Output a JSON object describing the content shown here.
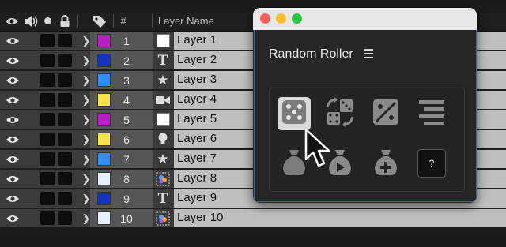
{
  "header": {
    "label_icon": "tag-icon",
    "number_label": "#",
    "name_label": "Layer Name"
  },
  "layers": [
    {
      "num": "1",
      "name": "Layer 1",
      "color": "#b71fc4",
      "source_icon": "solid-white-icon"
    },
    {
      "num": "2",
      "name": "Layer 2",
      "color": "#1533c0",
      "source_icon": "text-icon"
    },
    {
      "num": "3",
      "name": "Layer 3",
      "color": "#2e8ef7",
      "source_icon": "star-icon"
    },
    {
      "num": "4",
      "name": "Layer 4",
      "color": "#f5e34a",
      "source_icon": "camera-icon"
    },
    {
      "num": "5",
      "name": "Layer 5",
      "color": "#b71fc4",
      "source_icon": "solid-white-icon"
    },
    {
      "num": "6",
      "name": "Layer 6",
      "color": "#f5e34a",
      "source_icon": "light-bulb-icon"
    },
    {
      "num": "7",
      "name": "Layer 7",
      "color": "#2e8ef7",
      "source_icon": "star-icon"
    },
    {
      "num": "8",
      "name": "Layer 8",
      "color": "#e8f1fb",
      "source_icon": "precomp-icon"
    },
    {
      "num": "9",
      "name": "Layer 9",
      "color": "#1533c0",
      "source_icon": "text-icon"
    },
    {
      "num": "10",
      "name": "Layer 10",
      "color": "#e8f1fb",
      "source_icon": "precomp-icon"
    }
  ],
  "window": {
    "title": "Random Roller",
    "menu_icon": "hamburger-menu-icon",
    "tools_row1": [
      "dice-icon",
      "shuffle-dice-icon",
      "random-range-icon",
      "stack-lines-icon"
    ],
    "tools_row2": [
      "money-bag-icon",
      "money-bag-play-icon",
      "money-bag-plus-icon",
      "help-icon"
    ],
    "help_label": "?"
  },
  "text_glyphs": {
    "text_icon": "T",
    "chevron": "❯",
    "star": "★"
  }
}
